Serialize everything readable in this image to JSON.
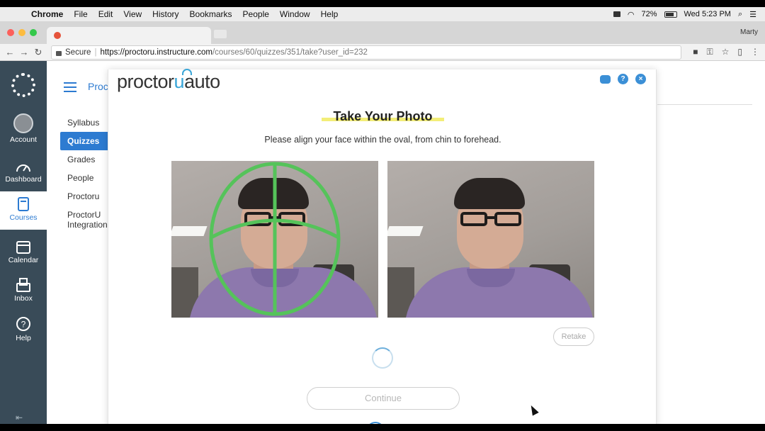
{
  "menubar": {
    "apple": "",
    "items": [
      "Chrome",
      "File",
      "Edit",
      "View",
      "History",
      "Bookmarks",
      "People",
      "Window",
      "Help"
    ],
    "battery": "72%",
    "clock": "Wed 5:23 PM"
  },
  "browser": {
    "profile": "Marty",
    "secure_label": "Secure",
    "url_host": "https://proctoru.instructure.com",
    "url_path": "/courses/60/quizzes/351/take?user_id=232"
  },
  "global_nav": [
    {
      "label": "Account",
      "icon": "avatar"
    },
    {
      "label": "Dashboard",
      "icon": "dashboard-icon"
    },
    {
      "label": "Courses",
      "icon": "book-icon",
      "active": true
    },
    {
      "label": "Calendar",
      "icon": "calendar-icon"
    },
    {
      "label": "Inbox",
      "icon": "inbox-icon"
    },
    {
      "label": "Help",
      "icon": "help-icon"
    }
  ],
  "course": {
    "breadcrumb": "Proc",
    "nav": [
      {
        "label": "Syllabus"
      },
      {
        "label": "Quizzes",
        "active": true
      },
      {
        "label": "Grades"
      },
      {
        "label": "People"
      },
      {
        "label": "Proctoru"
      },
      {
        "label": "ProctorU Integration"
      }
    ]
  },
  "modal": {
    "brand_left": "proctor",
    "brand_u": "u",
    "brand_right": "auto",
    "title": "Take Your Photo",
    "subtitle": "Please align your face within the oval, from chin to forehead.",
    "retake_label": "Retake",
    "continue_label": "Continue",
    "steps": [
      "done",
      "done",
      "current",
      "pending",
      "pending"
    ],
    "accent_color": "#3b8fd6",
    "guide_color": "#55c35a"
  }
}
